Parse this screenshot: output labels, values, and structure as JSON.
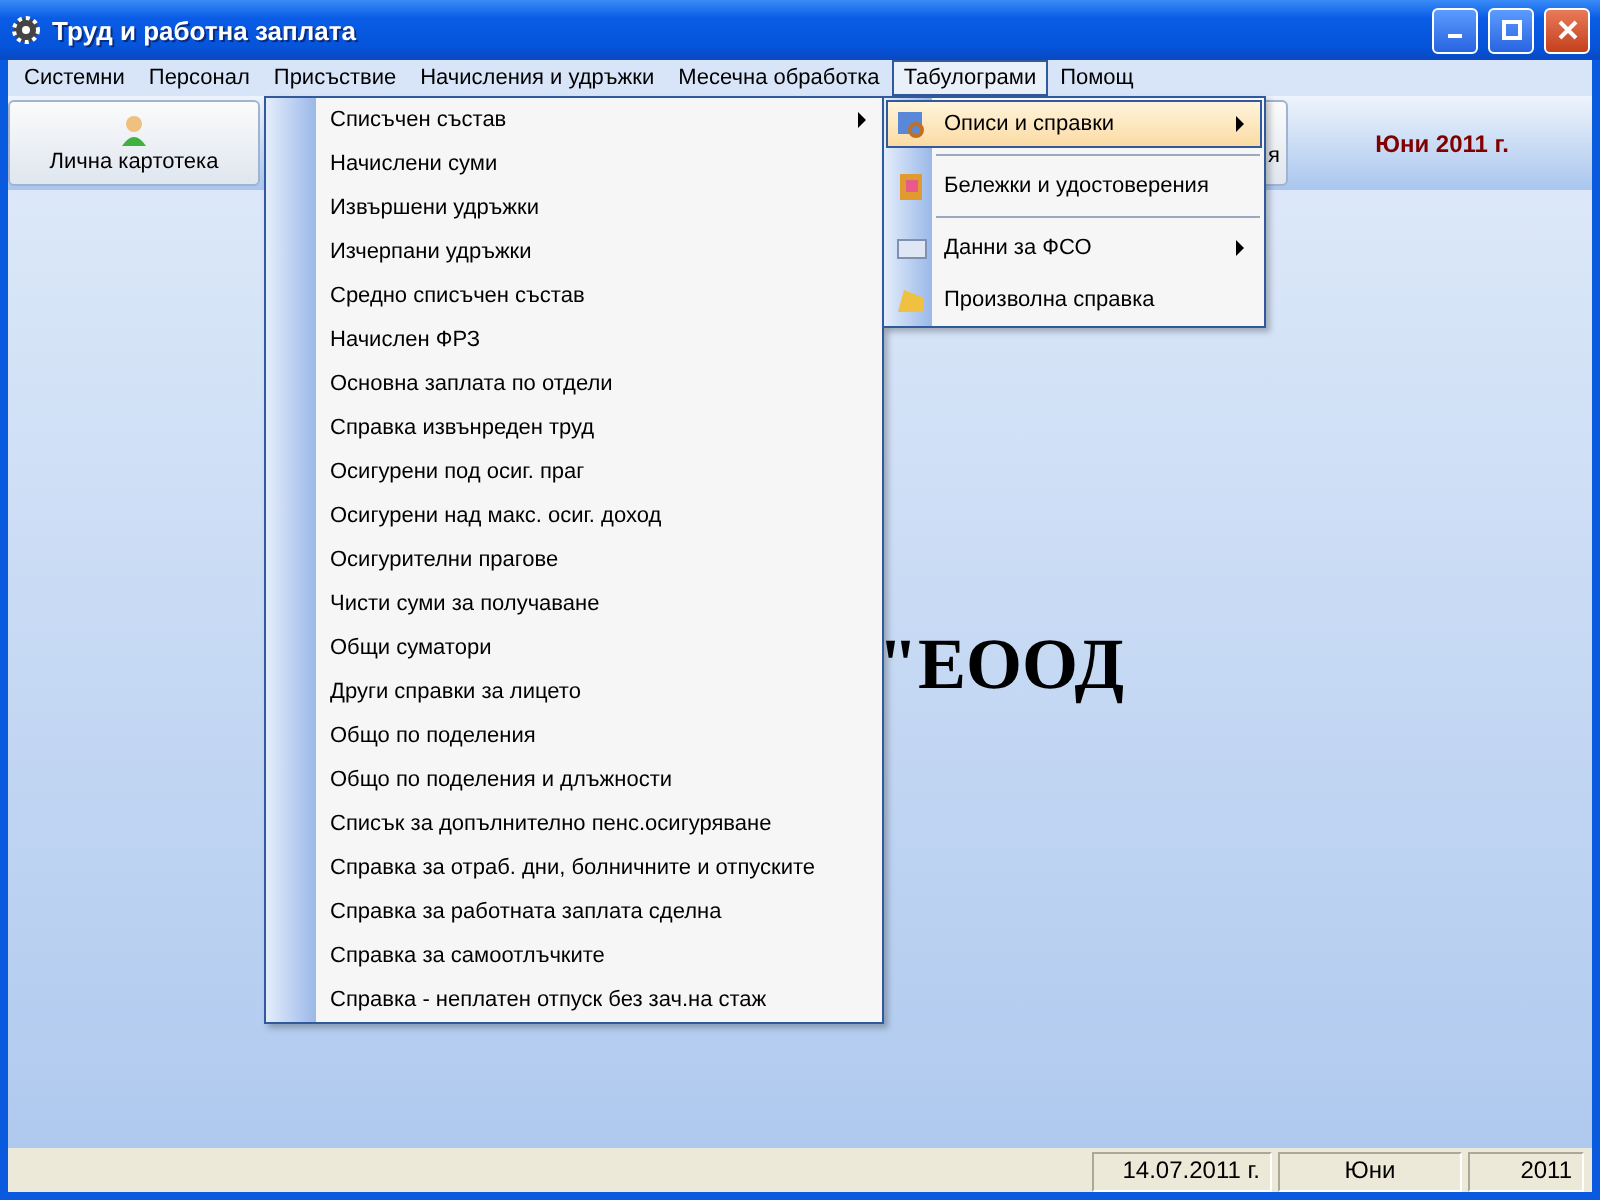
{
  "window": {
    "title": "Труд и работна заплата"
  },
  "menu_bar": [
    {
      "label": "Системни",
      "selected": false
    },
    {
      "label": "Персонал",
      "selected": false
    },
    {
      "label": "Присъствие",
      "selected": false
    },
    {
      "label": "Начисления и удръжки",
      "selected": false
    },
    {
      "label": "Месечна обработка",
      "selected": false
    },
    {
      "label": "Табулограми",
      "selected": true
    },
    {
      "label": "Помощ",
      "selected": false
    }
  ],
  "toolbar": {
    "buttons": [
      {
        "label": "Лична картотека"
      },
      {
        "label": "я"
      }
    ],
    "period": "Юни 2011 г."
  },
  "company_name": "\"ЕООД",
  "dropdown": [
    {
      "kind": "item",
      "label": "Описи и справки",
      "selected": true,
      "submenu": true
    },
    {
      "kind": "separator"
    },
    {
      "kind": "item",
      "label": "Бележки и удостоверения",
      "selected": false,
      "submenu": false
    },
    {
      "kind": "separator"
    },
    {
      "kind": "item",
      "label": "Данни за ФСО",
      "selected": false,
      "submenu": true
    },
    {
      "kind": "item",
      "label": "Произволна справка",
      "selected": false,
      "submenu": false
    }
  ],
  "submenu": [
    {
      "label": "Списъчен състав",
      "submenu": true
    },
    {
      "label": "Начислени суми",
      "submenu": false
    },
    {
      "label": "Извършени удръжки",
      "submenu": false
    },
    {
      "label": "Изчерпани удръжки",
      "submenu": false
    },
    {
      "label": "Средно списъчен състав",
      "submenu": false
    },
    {
      "label": "Начислен ФРЗ",
      "submenu": false
    },
    {
      "label": "Основна заплата по отдели",
      "submenu": false
    },
    {
      "label": "Справка извънреден труд",
      "submenu": false
    },
    {
      "label": "Осигурени под осиг. праг",
      "submenu": false
    },
    {
      "label": "Осигурени над макс. осиг. доход",
      "submenu": false
    },
    {
      "label": "Осигурителни прагове",
      "submenu": false
    },
    {
      "label": "Чисти суми за получаване",
      "submenu": false
    },
    {
      "label": "Общи суматори",
      "submenu": false
    },
    {
      "label": "Други справки за лицето",
      "submenu": false
    },
    {
      "label": "Общо по поделения",
      "submenu": false
    },
    {
      "label": "Общо по поделения и длъжности",
      "submenu": false
    },
    {
      "label": "Списък за допълнително пенс.осигуряване",
      "submenu": false
    },
    {
      "label": "Справка за отраб. дни, болничните и отпуските",
      "submenu": false
    },
    {
      "label": "Справка за работната заплата сделна",
      "submenu": false
    },
    {
      "label": "Справка за самоотлъчките",
      "submenu": false
    },
    {
      "label": "Справка - неплатен отпуск без зач.на стаж",
      "submenu": false
    }
  ],
  "status_bar": [
    "14.07.2011 г.",
    "Юни",
    "2011"
  ]
}
